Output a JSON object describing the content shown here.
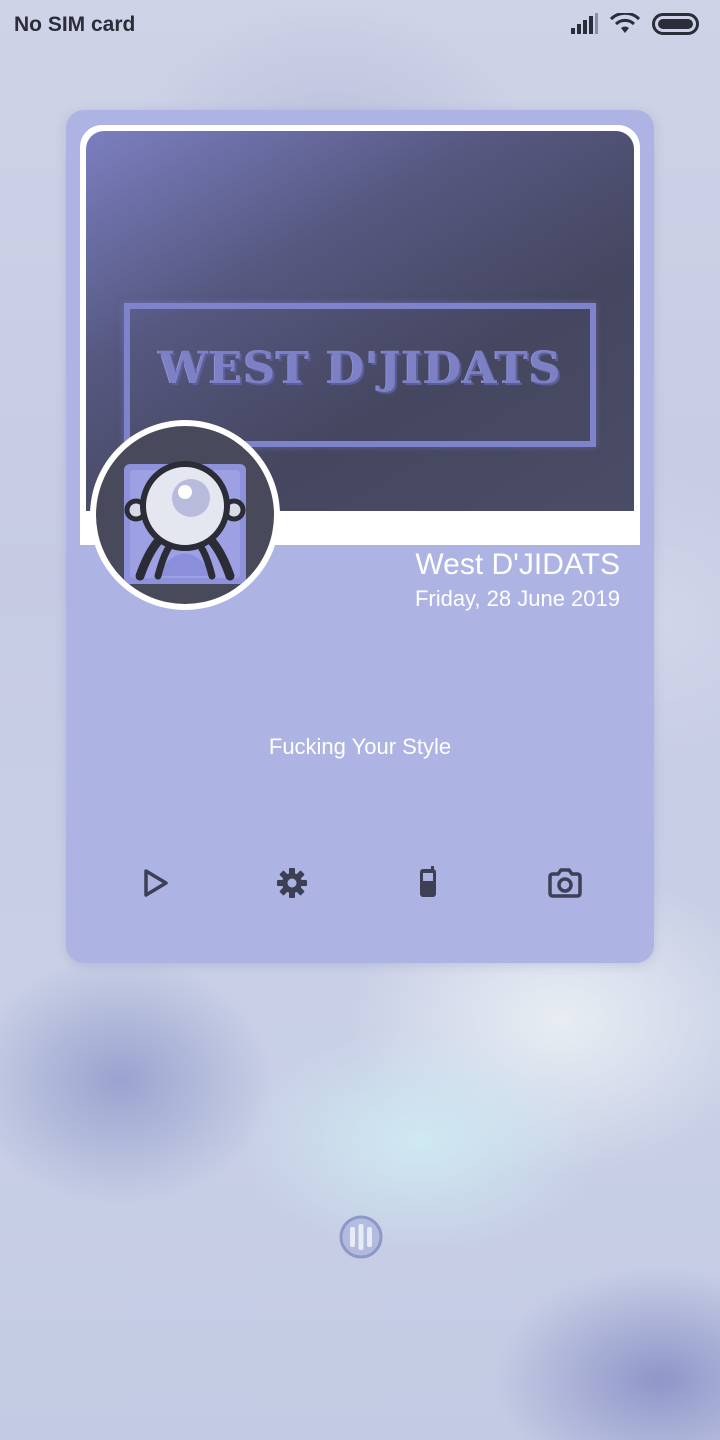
{
  "status_bar": {
    "carrier": "No SIM card",
    "icons": [
      "signal-icon",
      "wifi-icon",
      "battery-icon"
    ]
  },
  "profile": {
    "banner_text": "WEST D'JIDATS",
    "name": "West D'JIDATS",
    "date": "Friday, 28 June 2019",
    "quote": "Fucking Your Style"
  },
  "actions": [
    {
      "name": "play-button",
      "icon": "play-icon"
    },
    {
      "name": "settings-button",
      "icon": "gear-icon"
    },
    {
      "name": "phone-button",
      "icon": "phone-icon"
    },
    {
      "name": "camera-button",
      "icon": "camera-icon"
    }
  ],
  "colors": {
    "card": "#adb4e4",
    "banner_dark": "#45465f",
    "accent": "#7d80c4",
    "icon": "#3d3f55"
  }
}
